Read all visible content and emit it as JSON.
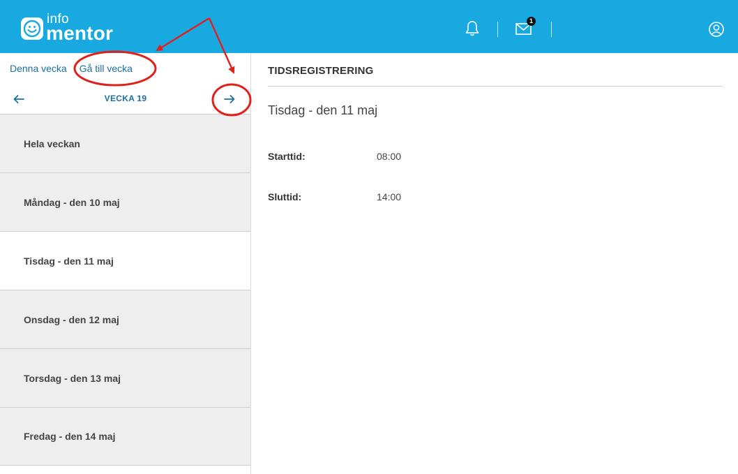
{
  "header": {
    "logo_info": "info",
    "logo_mentor": "mentor",
    "notification_badge": "1",
    "icons": [
      "bell-icon",
      "mail-icon",
      "profile-icon"
    ],
    "background_color": "#18a9e1"
  },
  "sidebar": {
    "this_week_label": "Denna vecka",
    "goto_week_label": "Gå till vecka",
    "week_label": "VECKA 19",
    "days": [
      {
        "label": "Hela veckan",
        "active": false
      },
      {
        "label": "Måndag - den 10 maj",
        "active": false
      },
      {
        "label": "Tisdag - den 11 maj",
        "active": true
      },
      {
        "label": "Onsdag - den 12 maj",
        "active": false
      },
      {
        "label": "Torsdag - den 13 maj",
        "active": false
      },
      {
        "label": "Fredag - den 14 maj",
        "active": false
      }
    ]
  },
  "main": {
    "section_title": "TIDSREGISTRERING",
    "day_title": "Tisdag - den 11 maj",
    "start_label": "Starttid:",
    "start_value": "08:00",
    "end_label": "Sluttid:",
    "end_value": "14:00"
  },
  "annotation_color": "#e0201b"
}
